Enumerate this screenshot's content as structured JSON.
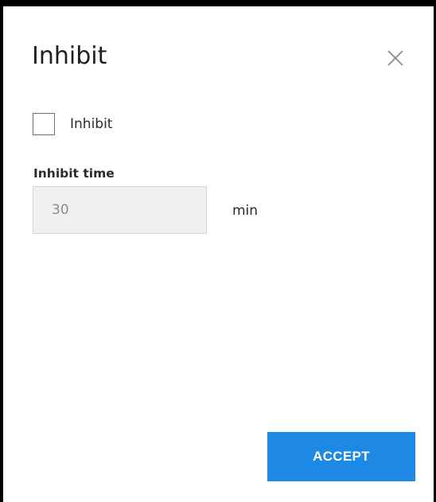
{
  "dialog": {
    "title": "Inhibit",
    "close_icon": "close-icon",
    "checkbox": {
      "label": "Inhibit",
      "checked": false
    },
    "inhibit_time": {
      "label": "Inhibit time",
      "value": "30",
      "unit": "min",
      "disabled": true
    },
    "accept_label": "ACCEPT"
  },
  "colors": {
    "accent": "#1e88e5",
    "input_background": "#f0f0f0",
    "text": "#2a2a2a"
  }
}
